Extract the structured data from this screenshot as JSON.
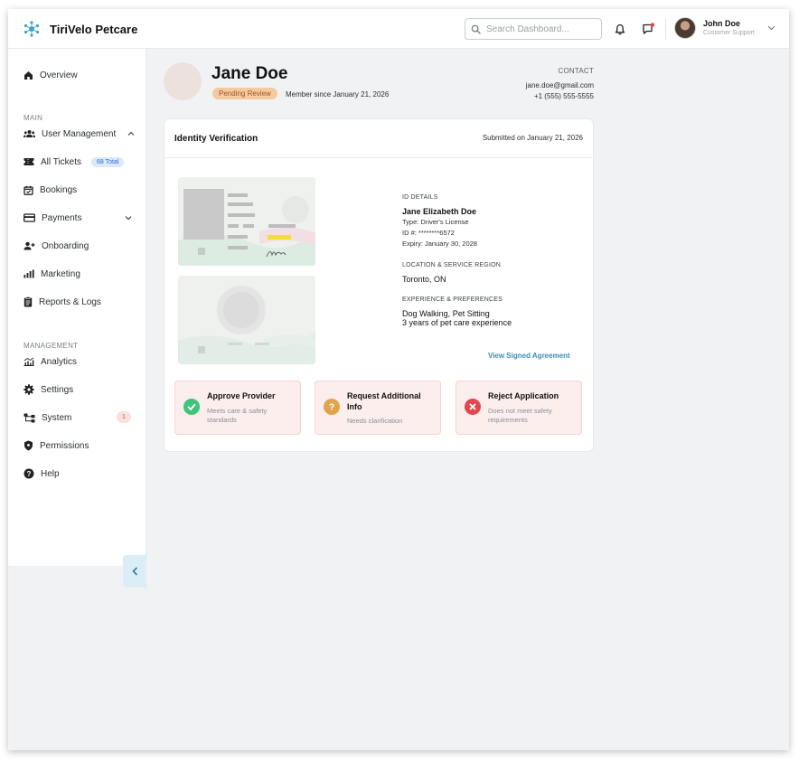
{
  "app": {
    "brand": "TiriVelo Petcare"
  },
  "header": {
    "search_placeholder": "Search Dashboard...",
    "user_name": "John Doe",
    "user_role": "Customer Support"
  },
  "sidebar": {
    "overview": "Overview",
    "main_label": "MAIN",
    "main_items": [
      {
        "label": "User Management"
      },
      {
        "label": "All Tickets",
        "badge": "68 Total"
      },
      {
        "label": "Bookings"
      },
      {
        "label": "Payments"
      },
      {
        "label": "Onboarding"
      },
      {
        "label": "Marketing"
      },
      {
        "label": "Reports & Logs"
      }
    ],
    "management_label": "MANAGEMENT",
    "management_items": [
      {
        "label": "Analytics"
      },
      {
        "label": "Settings"
      },
      {
        "label": "System",
        "badge": "1"
      },
      {
        "label": "Permissions"
      },
      {
        "label": "Help"
      }
    ]
  },
  "profile": {
    "name": "Jane Doe",
    "status": "Pending Review",
    "member_since": "Member since January 21, 2026",
    "contact_label": "CONTACT",
    "email": "jane.doe@gmail.com",
    "phone": "+1 (555) 555-5555"
  },
  "verification": {
    "title": "Identity Verification",
    "submitted": "Submitted on January 21, 2026",
    "id_details_label": "ID DETAILS",
    "full_name": "Jane Elizabeth Doe",
    "type": "Type: Driver's License",
    "id_number": "ID #: ********6572",
    "expiry": "Expiry: January 30, 2028",
    "location_label": "LOCATION & SERVICE REGION",
    "location": "Toronto, ON",
    "experience_label": "EXPERIENCE & PREFERENCES",
    "services": "Dog Walking, Pet Sitting",
    "experience": "3 years of pet care experience",
    "agreement_link": "View Signed Agreement"
  },
  "actions": [
    {
      "title": "Approve Provider",
      "subtitle": "Meets care & safety standards",
      "color": "#3fc47a"
    },
    {
      "title": "Request Additional Info",
      "subtitle": "Needs clarification",
      "color": "#e0a44a"
    },
    {
      "title": "Reject Application",
      "subtitle": "Does not meet safety requirements",
      "color": "#e2474f"
    }
  ]
}
